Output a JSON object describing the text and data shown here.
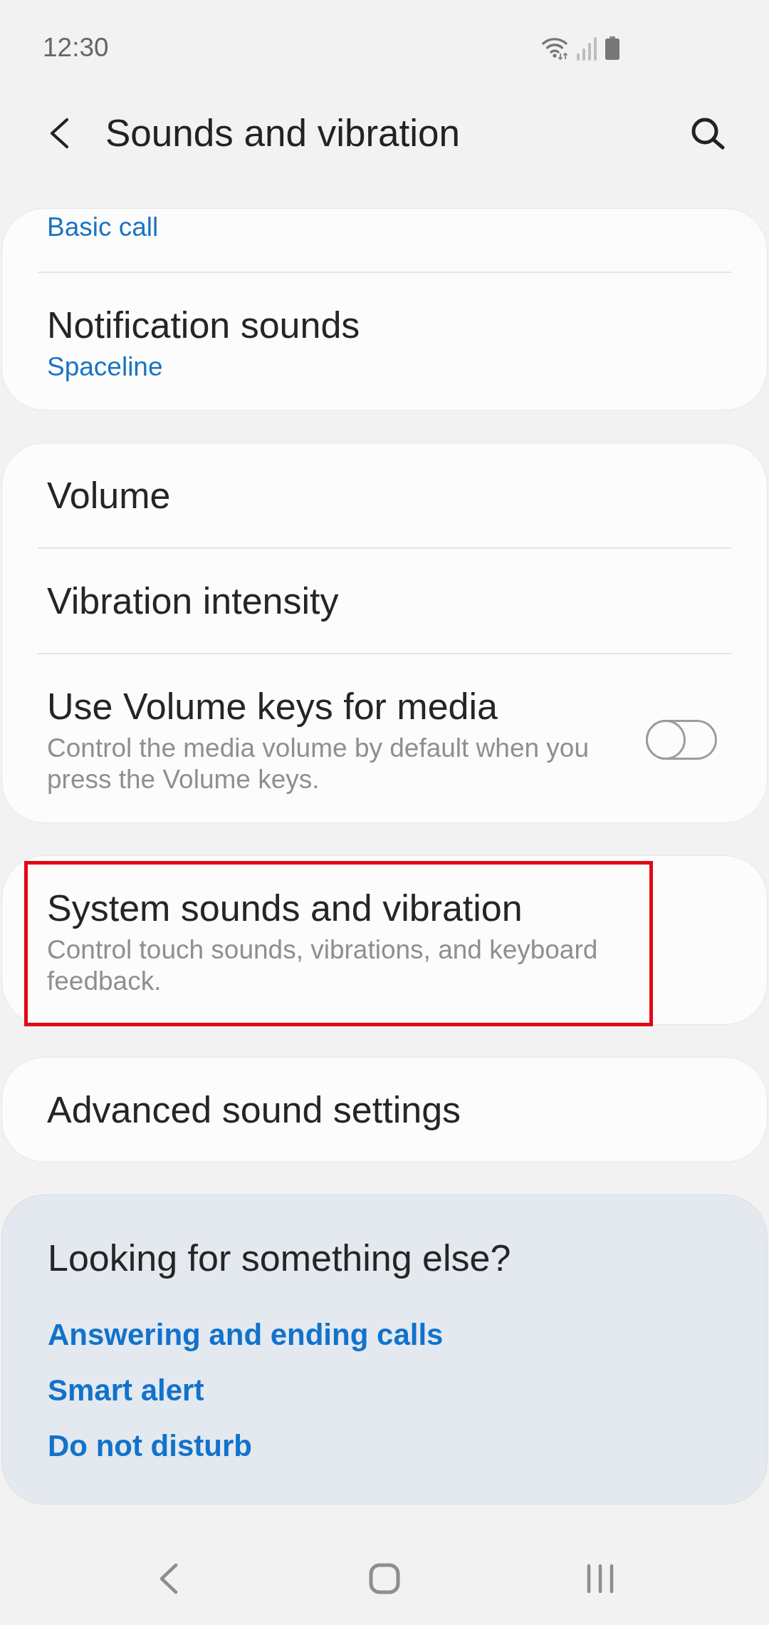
{
  "status_bar": {
    "time": "12:30"
  },
  "header": {
    "title": "Sounds and vibration"
  },
  "cards": [
    {
      "highlighted": false,
      "rows": [
        {
          "kind": "value",
          "subtitle": "Basic call"
        },
        {
          "kind": "value",
          "title": "Notification sounds",
          "subtitle": "Spaceline"
        }
      ]
    },
    {
      "highlighted": false,
      "rows": [
        {
          "kind": "text",
          "title": "Volume"
        },
        {
          "kind": "text",
          "title": "Vibration intensity"
        },
        {
          "kind": "switch",
          "title": "Use Volume keys for media",
          "subtitle": "Control the media volume by default when you press the Volume keys.",
          "on": false
        }
      ]
    },
    {
      "highlighted": true,
      "rows": [
        {
          "kind": "text",
          "title": "System sounds and vibration",
          "subtitle": "Control touch sounds, vibrations, and keyboard feedback."
        }
      ]
    },
    {
      "highlighted": false,
      "rows": [
        {
          "kind": "text",
          "title": "Advanced sound settings"
        }
      ]
    }
  ],
  "suggestions": {
    "heading": "Looking for something else?",
    "links": [
      "Answering and ending calls",
      "Smart alert",
      "Do not disturb"
    ]
  }
}
